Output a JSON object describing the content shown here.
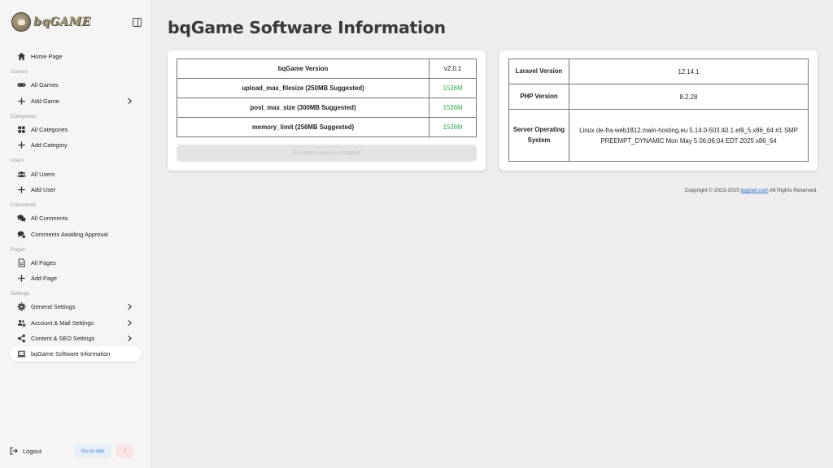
{
  "sidebar": {
    "logo_text": "bqGAME",
    "items": [
      {
        "label": "Home Page"
      },
      {
        "section": "Games"
      },
      {
        "label": "All Games"
      },
      {
        "label": "Add Game"
      },
      {
        "section": "Categories"
      },
      {
        "label": "All Categories"
      },
      {
        "label": "Add Category"
      },
      {
        "section": "Users"
      },
      {
        "label": "All Users"
      },
      {
        "label": "Add User"
      },
      {
        "section": "Comments"
      },
      {
        "label": "All Comments"
      },
      {
        "label": "Comments Awaiting Approval"
      },
      {
        "section": "Pages"
      },
      {
        "label": "All Pages"
      },
      {
        "label": "Add Page"
      },
      {
        "section": "Settings"
      },
      {
        "label": "General Settings"
      },
      {
        "label": "Account & Mail Settings"
      },
      {
        "label": "Content & SEO Settings"
      },
      {
        "label": "bqGame Software Information"
      }
    ],
    "footer": {
      "logout_label": "Logout",
      "goto_label": "Go to site",
      "warn_label": "!"
    }
  },
  "main": {
    "title": "bqGame Software Information",
    "version_table": [
      {
        "key": "bqGame Version",
        "value": "v2.0.1"
      },
      {
        "key": "upload_max_filesize (250MB Suggested)",
        "value": "1536M"
      },
      {
        "key": "post_max_size (300MB Suggested)",
        "value": "1536M"
      },
      {
        "key": "memory_limit (256MB Suggested)",
        "value": "1536M"
      }
    ],
    "latest_button": "The latest version is installed!",
    "env_table": [
      {
        "key": "Laravel Version",
        "value": "12.14.1"
      },
      {
        "key": "PHP Version",
        "value": "8.2.28"
      },
      {
        "key": "Server Operating System",
        "value": "Linux de-fra-web1812.main-hosting.eu 5.14.0-503.40.1.el9_5.x86_64 #1 SMP PREEMPT_DYNAMIC Mon May 5 06:06:04 EDT 2025 x86_64"
      }
    ],
    "copyright_prefix": "Copyright © 2023-2025",
    "copyright_link": "bqgnet.com",
    "copyright_suffix": "All Rights Reserved."
  },
  "colors": {
    "ok_green": "#2ea84a",
    "link_blue": "#2e6fd1",
    "sidebar_bg": "#f5f5f5",
    "page_bg": "#ededed"
  }
}
